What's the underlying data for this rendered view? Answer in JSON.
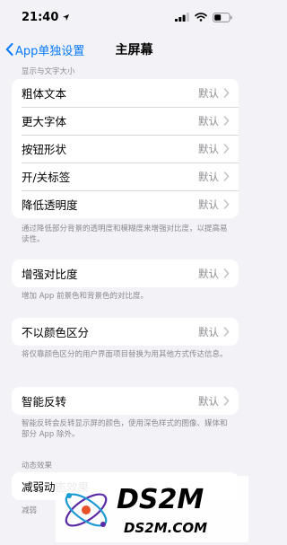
{
  "status": {
    "time": "21:40"
  },
  "nav": {
    "back_label": "App单独设置",
    "title": "主屏幕"
  },
  "sections": {
    "display_text_header": "显示与文字大小",
    "group1": [
      {
        "label": "粗体文本",
        "value": "默认"
      },
      {
        "label": "更大字体",
        "value": "默认"
      },
      {
        "label": "按钮形状",
        "value": "默认"
      },
      {
        "label": "开/关标签",
        "value": "默认"
      },
      {
        "label": "降低透明度",
        "value": "默认"
      }
    ],
    "group1_footnote": "通过降低部分背景的透明度和模糊度来增强对比度，以提高易读性。",
    "contrast": {
      "label": "增强对比度",
      "value": "默认"
    },
    "contrast_footnote": "增加 App 前景色和背景色的对比度。",
    "differentiate": {
      "label": "不以颜色区分",
      "value": "默认"
    },
    "differentiate_footnote": "将仅靠颜色区分的用户界面项目替换为用其他方式传达信息。",
    "invert": {
      "label": "智能反转",
      "value": "默认"
    },
    "invert_footnote": "智能反转会反转显示屏的颜色，使用深色样式的图像、媒体和部分 App 除外。",
    "motion_header": "动态效果",
    "motion_row_partial": "减弱动态效果",
    "motion_row2_partial": "减弱"
  },
  "watermark": {
    "brand": "DS2M",
    "domain": "DS2M.COM"
  }
}
